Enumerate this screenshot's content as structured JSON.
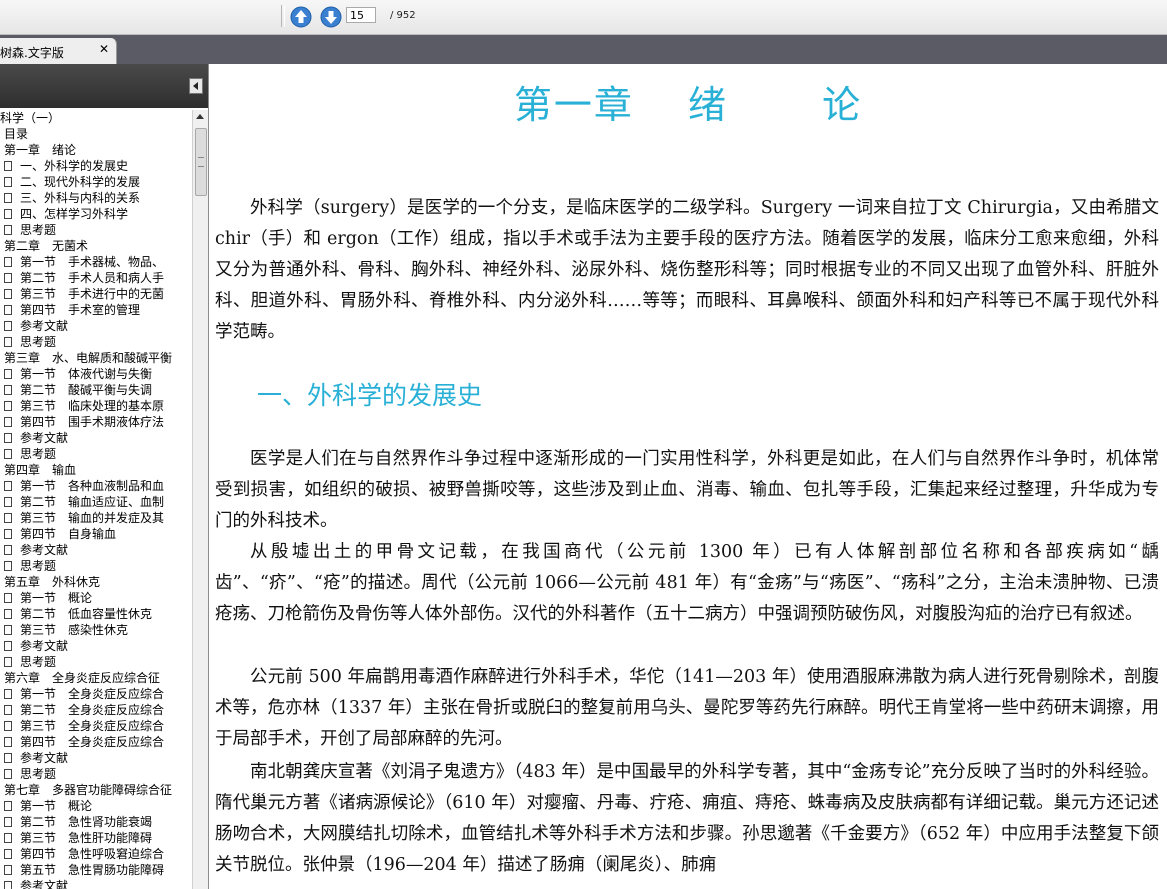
{
  "toolbar": {
    "current_page": "15",
    "total_pages": "/ 952",
    "prev_icon": "arrow-up-icon",
    "next_icon": "arrow-down-icon"
  },
  "tab": {
    "label": "树森.文字版",
    "close": "✕"
  },
  "sidebar": {
    "items": [
      {
        "label": "科学（一）",
        "level": "root"
      },
      {
        "label": "目录",
        "level": "chap"
      },
      {
        "label": "第一章　绪论",
        "level": "chap"
      },
      {
        "label": "一、外科学的发展史",
        "level": "leaf"
      },
      {
        "label": "二、现代外科学的发展",
        "level": "leaf"
      },
      {
        "label": "三、外科与内科的关系",
        "level": "leaf"
      },
      {
        "label": "四、怎样学习外科学",
        "level": "leaf"
      },
      {
        "label": "思考题",
        "level": "leaf"
      },
      {
        "label": "第二章　无菌术",
        "level": "chap"
      },
      {
        "label": "第一节　手术器械、物品、",
        "level": "leaf"
      },
      {
        "label": "第二节　手术人员和病人手",
        "level": "leaf"
      },
      {
        "label": "第三节　手术进行中的无菌",
        "level": "leaf"
      },
      {
        "label": "第四节　手术室的管理",
        "level": "leaf"
      },
      {
        "label": "参考文献",
        "level": "leaf"
      },
      {
        "label": "思考题",
        "level": "leaf"
      },
      {
        "label": "第三章　水、电解质和酸碱平衡",
        "level": "chap"
      },
      {
        "label": "第一节　体液代谢与失衡",
        "level": "leaf"
      },
      {
        "label": "第二节　酸碱平衡与失调",
        "level": "leaf"
      },
      {
        "label": "第三节　临床处理的基本原",
        "level": "leaf"
      },
      {
        "label": "第四节　围手术期液体疗法",
        "level": "leaf"
      },
      {
        "label": "参考文献",
        "level": "leaf"
      },
      {
        "label": "思考题",
        "level": "leaf"
      },
      {
        "label": "第四章　输血",
        "level": "chap"
      },
      {
        "label": "第一节　各种血液制品和血",
        "level": "leaf"
      },
      {
        "label": "第二节　输血适应证、血制",
        "level": "leaf"
      },
      {
        "label": "第三节　输血的并发症及其",
        "level": "leaf"
      },
      {
        "label": "第四节　自身输血",
        "level": "leaf"
      },
      {
        "label": "参考文献",
        "level": "leaf"
      },
      {
        "label": "思考题",
        "level": "leaf"
      },
      {
        "label": "第五章　外科休克",
        "level": "chap"
      },
      {
        "label": "第一节　概论",
        "level": "leaf"
      },
      {
        "label": "第二节　低血容量性休克",
        "level": "leaf"
      },
      {
        "label": "第三节　感染性休克",
        "level": "leaf"
      },
      {
        "label": "参考文献",
        "level": "leaf"
      },
      {
        "label": "思考题",
        "level": "leaf"
      },
      {
        "label": "第六章　全身炎症反应综合征",
        "level": "chap"
      },
      {
        "label": "第一节　全身炎症反应综合",
        "level": "leaf"
      },
      {
        "label": "第二节　全身炎症反应综合",
        "level": "leaf"
      },
      {
        "label": "第三节　全身炎症反应综合",
        "level": "leaf"
      },
      {
        "label": "第四节　全身炎症反应综合",
        "level": "leaf"
      },
      {
        "label": "参考文献",
        "level": "leaf"
      },
      {
        "label": "思考题",
        "level": "leaf"
      },
      {
        "label": "第七章　多器官功能障碍综合征",
        "level": "chap"
      },
      {
        "label": "第一节　概论",
        "level": "leaf"
      },
      {
        "label": "第二节　急性肾功能衰竭",
        "level": "leaf"
      },
      {
        "label": "第三节　急性肝功能障碍",
        "level": "leaf"
      },
      {
        "label": "第四节　急性呼吸窘迫综合",
        "level": "leaf"
      },
      {
        "label": "第五节　急性胃肠功能障碍",
        "level": "leaf"
      },
      {
        "label": "参考文献",
        "level": "leaf"
      }
    ]
  },
  "document": {
    "chapter_title": "第一章　 绪　　 论",
    "section_heading": "一、外科学的发展史",
    "paragraphs": [
      "外科学（surgery）是医学的一个分支，是临床医学的二级学科。Surgery 一词来自拉丁文 Chirurgia，又由希腊文 chir（手）和 ergon（工作）组成，指以手术或手法为主要手段的医疗方法。随着医学的发展，临床分工愈来愈细，外科又分为普通外科、骨科、胸外科、神经外科、泌尿外科、烧伤整形科等；同时根据专业的不同又出现了血管外科、肝脏外科、胆道外科、胃肠外科、脊椎外科、内分泌外科……等等；而眼科、耳鼻喉科、颌面外科和妇产科等已不属于现代外科学范畴。",
      "医学是人们在与自然界作斗争过程中逐渐形成的一门实用性科学，外科更是如此，在人们与自然界作斗争时，机体常受到损害，如组织的破损、被野兽撕咬等，这些涉及到止血、消毒、输血、包扎等手段，汇集起来经过整理，升华成为专门的外科技术。",
      "从殷墟出土的甲骨文记载，在我国商代（公元前 1300 年）已有人体解剖部位名称和各部疾病如“龋齿”、“疥”、“疮”的描述。周代（公元前 1066—公元前 481 年）有“金疡”与“疡医”、“疡科”之分，主治未溃肿物、已溃疮疡、刀枪箭伤及骨伤等人体外部伤。汉代的外科著作（五十二病方）中强调预防破伤风，对腹股沟疝的治疗已有叙述。",
      "公元前 500 年扁鹊用毒酒作麻醉进行外科手术，华佗（141—203 年）使用酒服麻沸散为病人进行死骨剔除术，剖腹术等，危亦林（1337 年）主张在骨折或脱臼的整复前用乌头、曼陀罗等药先行麻醉。明代王肯堂将一些中药研末调擦，用于局部手术，开创了局部麻醉的先河。",
      "南北朝龚庆宣著《刘涓子鬼遗方》（483 年）是中国最早的外科学专著，其中“金疡专论”充分反映了当时的外科经验。隋代巢元方著《诸病源候论》（610 年）对瘿瘤、丹毒、疔疮、痈疽、痔疮、蛛毒病及皮肤病都有详细记载。巢元方还记述肠吻合术，大网膜结扎切除术，血管结扎术等外科手术方法和步骤。孙思邈著《千金要方》（652 年）中应用手法整复下颌关节脱位。张仲景（196—204 年）描述了肠痈（阑尾炎）、肺痈"
    ]
  },
  "colors": {
    "heading": "#29b0d6",
    "tabstrip": "#5b5b66",
    "sidebar_header": "#3a3a3a"
  }
}
